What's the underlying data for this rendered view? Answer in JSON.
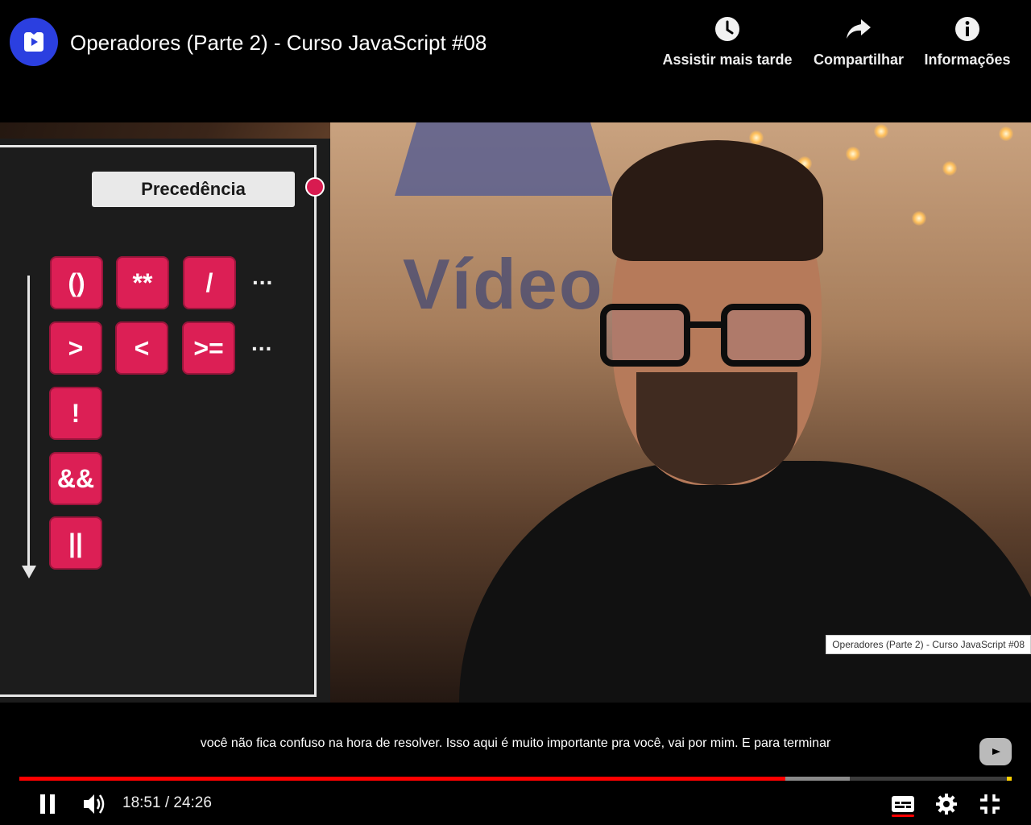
{
  "header": {
    "title": "Operadores (Parte 2) - Curso JavaScript #08",
    "channel_logo_icon": "channel-play-logo-icon",
    "actions": [
      {
        "label": "Assistir mais tarde",
        "icon": "clock-icon"
      },
      {
        "label": "Compartilhar",
        "icon": "share-arrow-icon"
      },
      {
        "label": "Informações",
        "icon": "info-icon"
      }
    ]
  },
  "panel": {
    "title": "Precedência",
    "operators": [
      [
        "()",
        "**",
        "/",
        "..."
      ],
      [
        ">",
        "<",
        ">=",
        "..."
      ],
      [
        "!"
      ],
      [
        "&&"
      ],
      [
        "||"
      ]
    ],
    "accent_color": "#dc1f55"
  },
  "video": {
    "background_word": "Vídeo",
    "watermark": "Operadores (Parte 2) - Curso JavaScript #08"
  },
  "caption": "você não fica confuso na hora de resolver. Isso aqui é muito importante pra você, vai por mim. E para terminar",
  "player": {
    "current_time": "18:51",
    "separator": "/",
    "duration": "24:26",
    "played_fraction": 0.772,
    "buffered_fraction": 0.837,
    "controls": {
      "play_pause_icon": "pause-icon",
      "volume_icon": "volume-icon",
      "subtitles_icon": "subtitles-icon",
      "settings_icon": "gear-icon",
      "fullscreen_icon": "exit-fullscreen-icon"
    },
    "progress_color": "#ff0000"
  }
}
